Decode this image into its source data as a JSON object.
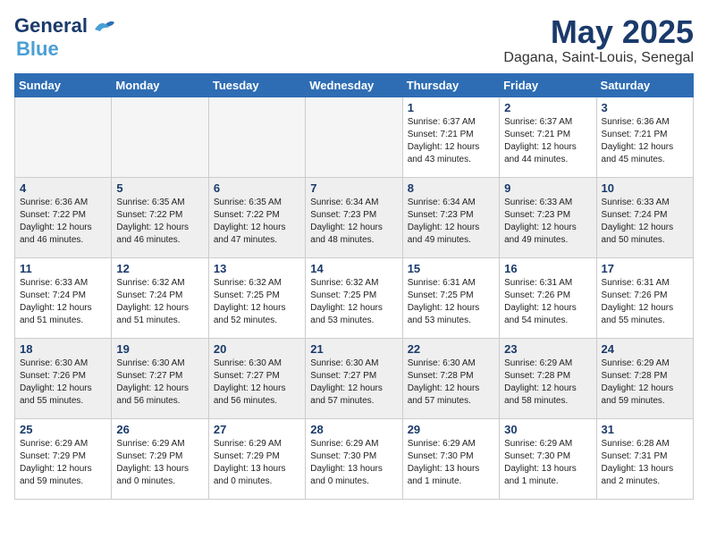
{
  "header": {
    "logo_general": "General",
    "logo_blue": "Blue",
    "title": "May 2025",
    "subtitle": "Dagana, Saint-Louis, Senegal"
  },
  "weekdays": [
    "Sunday",
    "Monday",
    "Tuesday",
    "Wednesday",
    "Thursday",
    "Friday",
    "Saturday"
  ],
  "weeks": [
    [
      {
        "day": "",
        "info": "",
        "empty": true
      },
      {
        "day": "",
        "info": "",
        "empty": true
      },
      {
        "day": "",
        "info": "",
        "empty": true
      },
      {
        "day": "",
        "info": "",
        "empty": true
      },
      {
        "day": "1",
        "info": "Sunrise: 6:37 AM\nSunset: 7:21 PM\nDaylight: 12 hours\nand 43 minutes."
      },
      {
        "day": "2",
        "info": "Sunrise: 6:37 AM\nSunset: 7:21 PM\nDaylight: 12 hours\nand 44 minutes."
      },
      {
        "day": "3",
        "info": "Sunrise: 6:36 AM\nSunset: 7:21 PM\nDaylight: 12 hours\nand 45 minutes."
      }
    ],
    [
      {
        "day": "4",
        "info": "Sunrise: 6:36 AM\nSunset: 7:22 PM\nDaylight: 12 hours\nand 46 minutes."
      },
      {
        "day": "5",
        "info": "Sunrise: 6:35 AM\nSunset: 7:22 PM\nDaylight: 12 hours\nand 46 minutes."
      },
      {
        "day": "6",
        "info": "Sunrise: 6:35 AM\nSunset: 7:22 PM\nDaylight: 12 hours\nand 47 minutes."
      },
      {
        "day": "7",
        "info": "Sunrise: 6:34 AM\nSunset: 7:23 PM\nDaylight: 12 hours\nand 48 minutes."
      },
      {
        "day": "8",
        "info": "Sunrise: 6:34 AM\nSunset: 7:23 PM\nDaylight: 12 hours\nand 49 minutes."
      },
      {
        "day": "9",
        "info": "Sunrise: 6:33 AM\nSunset: 7:23 PM\nDaylight: 12 hours\nand 49 minutes."
      },
      {
        "day": "10",
        "info": "Sunrise: 6:33 AM\nSunset: 7:24 PM\nDaylight: 12 hours\nand 50 minutes."
      }
    ],
    [
      {
        "day": "11",
        "info": "Sunrise: 6:33 AM\nSunset: 7:24 PM\nDaylight: 12 hours\nand 51 minutes."
      },
      {
        "day": "12",
        "info": "Sunrise: 6:32 AM\nSunset: 7:24 PM\nDaylight: 12 hours\nand 51 minutes."
      },
      {
        "day": "13",
        "info": "Sunrise: 6:32 AM\nSunset: 7:25 PM\nDaylight: 12 hours\nand 52 minutes."
      },
      {
        "day": "14",
        "info": "Sunrise: 6:32 AM\nSunset: 7:25 PM\nDaylight: 12 hours\nand 53 minutes."
      },
      {
        "day": "15",
        "info": "Sunrise: 6:31 AM\nSunset: 7:25 PM\nDaylight: 12 hours\nand 53 minutes."
      },
      {
        "day": "16",
        "info": "Sunrise: 6:31 AM\nSunset: 7:26 PM\nDaylight: 12 hours\nand 54 minutes."
      },
      {
        "day": "17",
        "info": "Sunrise: 6:31 AM\nSunset: 7:26 PM\nDaylight: 12 hours\nand 55 minutes."
      }
    ],
    [
      {
        "day": "18",
        "info": "Sunrise: 6:30 AM\nSunset: 7:26 PM\nDaylight: 12 hours\nand 55 minutes."
      },
      {
        "day": "19",
        "info": "Sunrise: 6:30 AM\nSunset: 7:27 PM\nDaylight: 12 hours\nand 56 minutes."
      },
      {
        "day": "20",
        "info": "Sunrise: 6:30 AM\nSunset: 7:27 PM\nDaylight: 12 hours\nand 56 minutes."
      },
      {
        "day": "21",
        "info": "Sunrise: 6:30 AM\nSunset: 7:27 PM\nDaylight: 12 hours\nand 57 minutes."
      },
      {
        "day": "22",
        "info": "Sunrise: 6:30 AM\nSunset: 7:28 PM\nDaylight: 12 hours\nand 57 minutes."
      },
      {
        "day": "23",
        "info": "Sunrise: 6:29 AM\nSunset: 7:28 PM\nDaylight: 12 hours\nand 58 minutes."
      },
      {
        "day": "24",
        "info": "Sunrise: 6:29 AM\nSunset: 7:28 PM\nDaylight: 12 hours\nand 59 minutes."
      }
    ],
    [
      {
        "day": "25",
        "info": "Sunrise: 6:29 AM\nSunset: 7:29 PM\nDaylight: 12 hours\nand 59 minutes."
      },
      {
        "day": "26",
        "info": "Sunrise: 6:29 AM\nSunset: 7:29 PM\nDaylight: 13 hours\nand 0 minutes."
      },
      {
        "day": "27",
        "info": "Sunrise: 6:29 AM\nSunset: 7:29 PM\nDaylight: 13 hours\nand 0 minutes."
      },
      {
        "day": "28",
        "info": "Sunrise: 6:29 AM\nSunset: 7:30 PM\nDaylight: 13 hours\nand 0 minutes."
      },
      {
        "day": "29",
        "info": "Sunrise: 6:29 AM\nSunset: 7:30 PM\nDaylight: 13 hours\nand 1 minute."
      },
      {
        "day": "30",
        "info": "Sunrise: 6:29 AM\nSunset: 7:30 PM\nDaylight: 13 hours\nand 1 minute."
      },
      {
        "day": "31",
        "info": "Sunrise: 6:28 AM\nSunset: 7:31 PM\nDaylight: 13 hours\nand 2 minutes."
      }
    ]
  ]
}
